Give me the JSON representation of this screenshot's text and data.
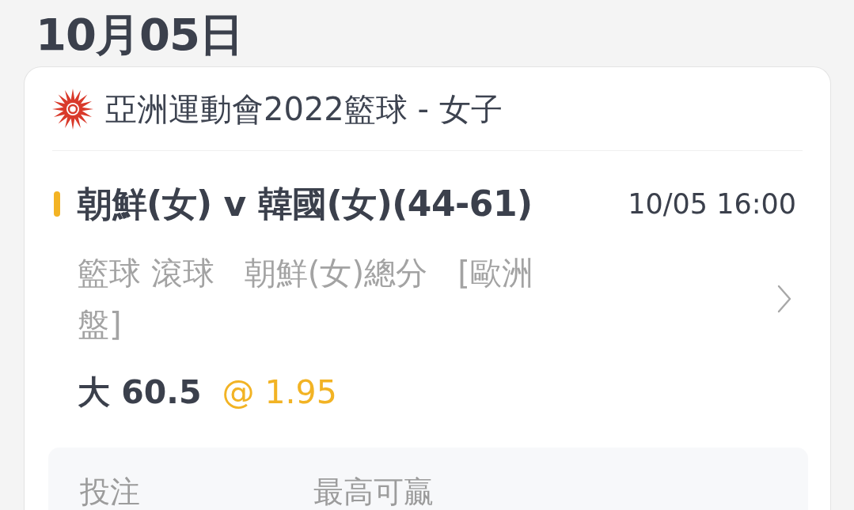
{
  "date_header": "10月05日",
  "competition": {
    "title": "亞洲運動會2022籃球 - 女子"
  },
  "bet": {
    "match": "朝鮮(女) v 韓國(女)(44-61)",
    "time": "10/05 16:00",
    "market": "籃球 滾球   朝鮮(女)總分   [歐洲盤]",
    "selection": "大 60.5",
    "odds": "@ 1.95"
  },
  "summary": {
    "columns": [
      "投注",
      "最高可贏"
    ]
  }
}
